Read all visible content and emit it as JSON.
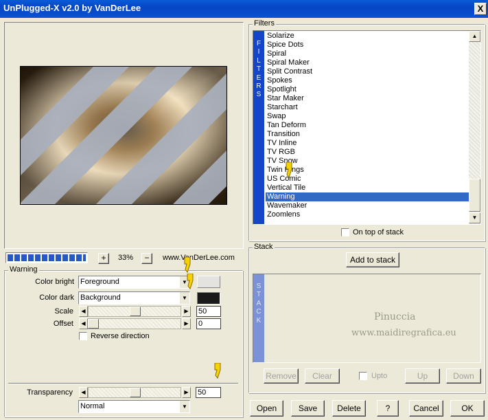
{
  "window": {
    "title": "UnPlugged-X v2.0 by VanDerLee",
    "close_label": "X"
  },
  "preview": {
    "zoom": "33%",
    "zoom_in_label": "+",
    "zoom_out_label": "−",
    "website": "www.VanDerLee.com"
  },
  "filters": {
    "group_title": "Filters",
    "side_label": "FILTERS",
    "items": [
      "Solarize",
      "Spice Dots",
      "Spiral",
      "Spiral Maker",
      "Split Contrast",
      "Spokes",
      "Spotlight",
      "Star Maker",
      "Starchart",
      "Swap",
      "Tan Deform",
      "Transition",
      "TV Inline",
      "TV RGB",
      "TV Snow",
      "Twin Rings",
      "US Comic",
      "Vertical Tile",
      "Warning",
      "Wavemaker",
      "Zoomlens"
    ],
    "selected": "Warning",
    "on_top_label": "On top of stack"
  },
  "stack": {
    "group_title": "Stack",
    "side_label": "STACK",
    "add_label": "Add to stack",
    "remove_label": "Remove",
    "clear_label": "Clear",
    "upto_label": "Upto",
    "up_label": "Up",
    "down_label": "Down",
    "watermark_line1": "Pinuccia",
    "watermark_line2": "www.maidiregrafica.eu"
  },
  "settings": {
    "group_title": "Warning",
    "color_bright_label": "Color bright",
    "color_bright_value": "Foreground",
    "color_dark_label": "Color dark",
    "color_dark_value": "Background",
    "scale_label": "Scale",
    "scale_value": "50",
    "offset_label": "Offset",
    "offset_value": "0",
    "reverse_label": "Reverse direction",
    "transparency_label": "Transparency",
    "transparency_value": "50",
    "blend_mode": "Normal"
  },
  "buttons": {
    "open": "Open",
    "save": "Save",
    "delete": "Delete",
    "help": "?",
    "cancel": "Cancel",
    "ok": "OK"
  },
  "colors": {
    "title_blue": "#0645c4",
    "selection": "#316ac5",
    "filters_bar": "#1545c8",
    "stack_bar": "#7b93d6",
    "bright_swatch": "#e4e3e0",
    "dark_swatch": "#1b1a1a"
  }
}
